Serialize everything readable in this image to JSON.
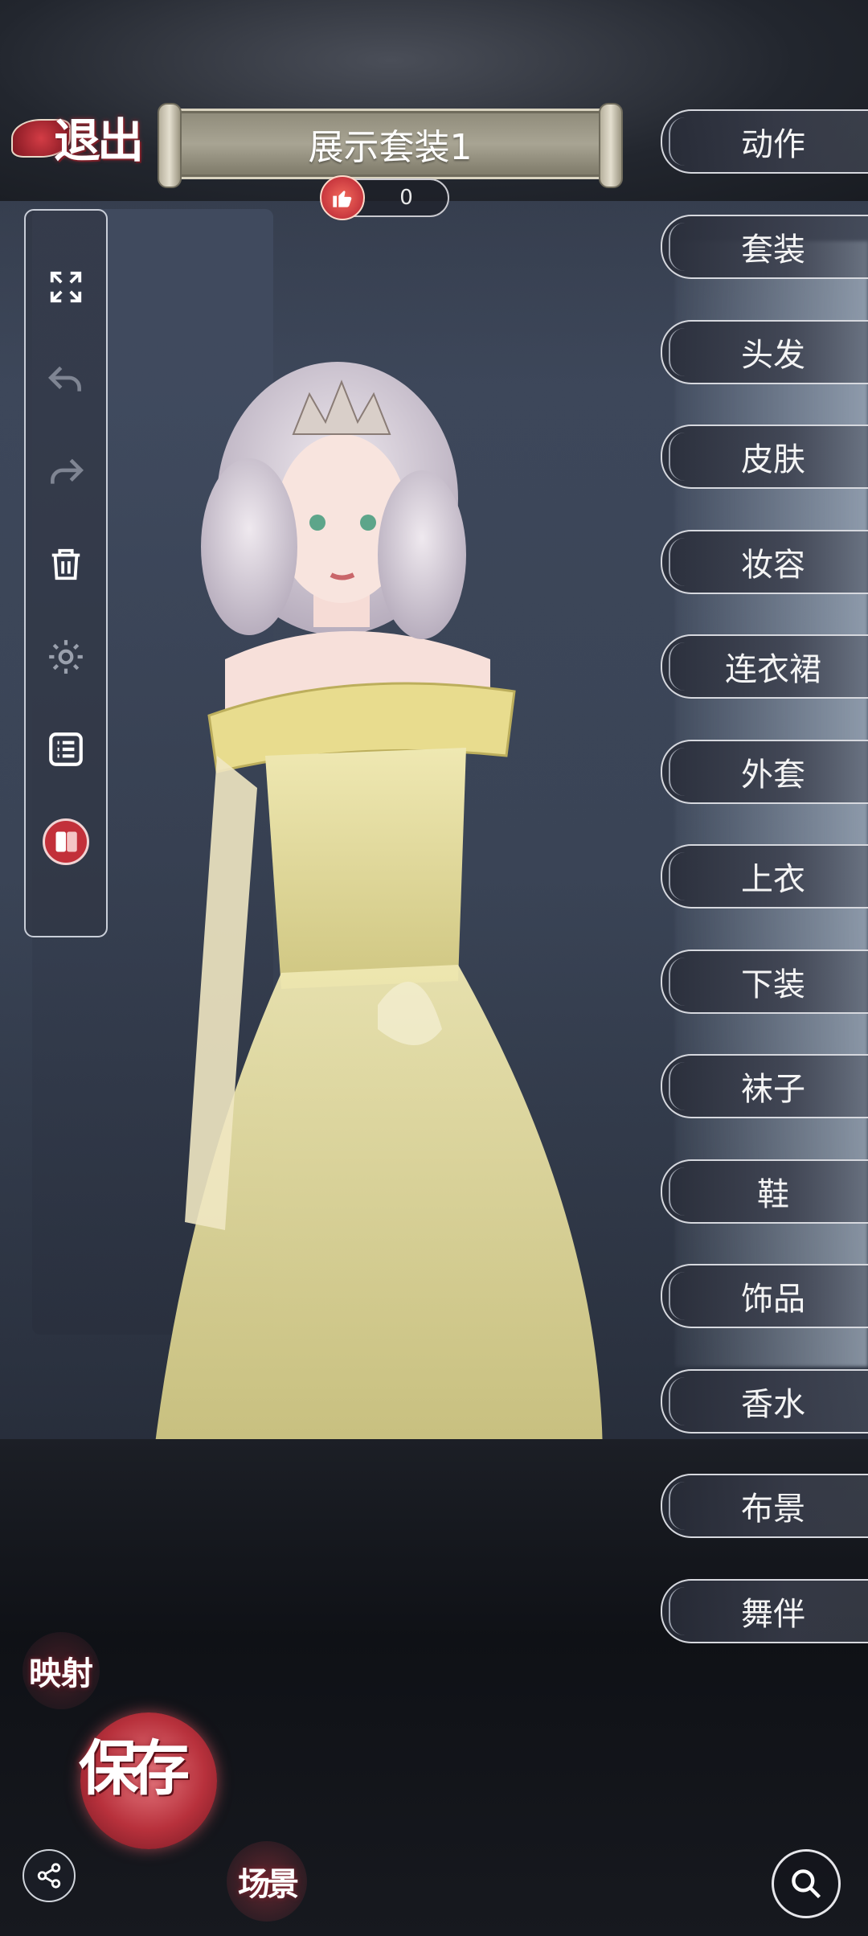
{
  "exit": {
    "label": "退出"
  },
  "title": {
    "text": "展示套装1",
    "likes": "0"
  },
  "left_toolbar": [
    {
      "name": "fullscreen-icon"
    },
    {
      "name": "undo-icon"
    },
    {
      "name": "redo-icon"
    },
    {
      "name": "trash-icon"
    },
    {
      "name": "gear-icon"
    },
    {
      "name": "list-icon"
    },
    {
      "name": "wardrobe-icon"
    }
  ],
  "categories": [
    "动作",
    "套装",
    "头发",
    "皮肤",
    "妆容",
    "连衣裙",
    "外套",
    "上衣",
    "下装",
    "袜子",
    "鞋",
    "饰品",
    "香水",
    "布景",
    "舞伴"
  ],
  "bottom": {
    "mapping_label": "映射",
    "save_label": "保存",
    "scene_label": "场景"
  },
  "colors": {
    "accent": "#c2303a",
    "menu_bg": "#323848",
    "dress": "#e9e3a8"
  }
}
